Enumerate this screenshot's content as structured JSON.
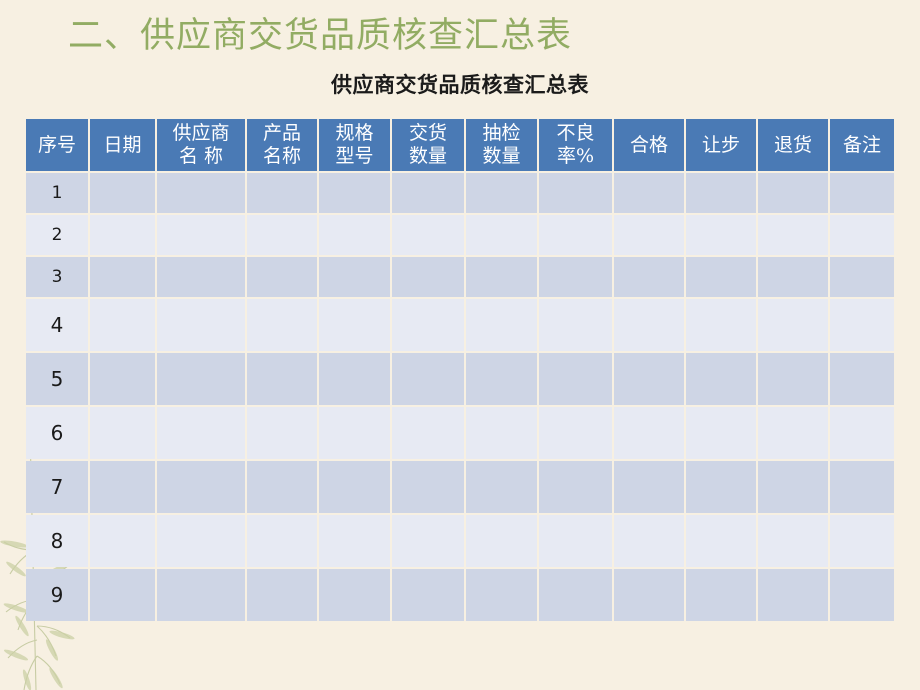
{
  "slide": {
    "title": "二、供应商交货品质核查汇总表",
    "title_color": "#92ac63",
    "background_color": "#f7f0e2"
  },
  "table": {
    "caption": "供应商交货品质核查汇总表",
    "header_bg": "#4a7ab5",
    "row_odd_bg": "#ced5e5",
    "row_even_bg": "#e7eaf3",
    "columns": [
      {
        "key": "seq",
        "label": "序号"
      },
      {
        "key": "date",
        "label": "日期"
      },
      {
        "key": "supplier",
        "label": "供应商\n名  称"
      },
      {
        "key": "product",
        "label": "产品\n名称"
      },
      {
        "key": "spec",
        "label": "规格\n型号"
      },
      {
        "key": "delivery",
        "label": "交货\n数量"
      },
      {
        "key": "sampled",
        "label": "抽检\n数量"
      },
      {
        "key": "defect",
        "label": "不良\n率%"
      },
      {
        "key": "pass",
        "label": "合格"
      },
      {
        "key": "concede",
        "label": "让步"
      },
      {
        "key": "return",
        "label": "退货"
      },
      {
        "key": "remark",
        "label": "备注"
      }
    ],
    "rows": [
      {
        "seq": "1",
        "date": "",
        "supplier": "",
        "product": "",
        "spec": "",
        "delivery": "",
        "sampled": "",
        "defect": "",
        "pass": "",
        "concede": "",
        "return": "",
        "remark": ""
      },
      {
        "seq": "2",
        "date": "",
        "supplier": "",
        "product": "",
        "spec": "",
        "delivery": "",
        "sampled": "",
        "defect": "",
        "pass": "",
        "concede": "",
        "return": "",
        "remark": ""
      },
      {
        "seq": "3",
        "date": "",
        "supplier": "",
        "product": "",
        "spec": "",
        "delivery": "",
        "sampled": "",
        "defect": "",
        "pass": "",
        "concede": "",
        "return": "",
        "remark": ""
      },
      {
        "seq": "4",
        "date": "",
        "supplier": "",
        "product": "",
        "spec": "",
        "delivery": "",
        "sampled": "",
        "defect": "",
        "pass": "",
        "concede": "",
        "return": "",
        "remark": ""
      },
      {
        "seq": "5",
        "date": "",
        "supplier": "",
        "product": "",
        "spec": "",
        "delivery": "",
        "sampled": "",
        "defect": "",
        "pass": "",
        "concede": "",
        "return": "",
        "remark": ""
      },
      {
        "seq": "6",
        "date": "",
        "supplier": "",
        "product": "",
        "spec": "",
        "delivery": "",
        "sampled": "",
        "defect": "",
        "pass": "",
        "concede": "",
        "return": "",
        "remark": ""
      },
      {
        "seq": "7",
        "date": "",
        "supplier": "",
        "product": "",
        "spec": "",
        "delivery": "",
        "sampled": "",
        "defect": "",
        "pass": "",
        "concede": "",
        "return": "",
        "remark": ""
      },
      {
        "seq": "8",
        "date": "",
        "supplier": "",
        "product": "",
        "spec": "",
        "delivery": "",
        "sampled": "",
        "defect": "",
        "pass": "",
        "concede": "",
        "return": "",
        "remark": ""
      },
      {
        "seq": "9",
        "date": "",
        "supplier": "",
        "product": "",
        "spec": "",
        "delivery": "",
        "sampled": "",
        "defect": "",
        "pass": "",
        "concede": "",
        "return": "",
        "remark": ""
      }
    ]
  },
  "decoration": {
    "name": "bamboo-leaves-watermark",
    "color": "#b9c08c"
  }
}
